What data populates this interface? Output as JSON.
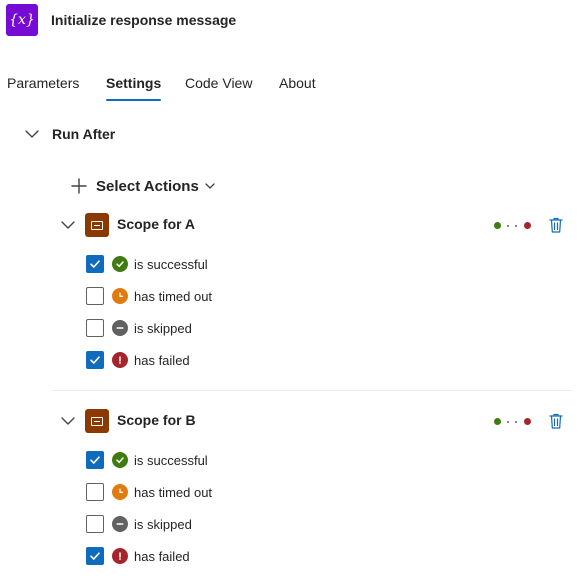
{
  "header": {
    "title": "Initialize response message",
    "icon": "variable-icon",
    "icon_glyph": "{x}",
    "icon_color": "#770bd6"
  },
  "tabs": [
    {
      "label": "Parameters",
      "active": false
    },
    {
      "label": "Settings",
      "active": true
    },
    {
      "label": "Code View",
      "active": false
    },
    {
      "label": "About",
      "active": false
    }
  ],
  "run_after": {
    "label": "Run After",
    "expanded": true
  },
  "select_actions": {
    "label": "Select Actions"
  },
  "colors": {
    "accent": "#0f6cbd",
    "scope_icon": "#8c3900",
    "success": "#3f7b0e",
    "timeout": "#e07b10",
    "skipped": "#616161",
    "failed": "#a4262c"
  },
  "scopes": [
    {
      "name": "Scope for A",
      "options": [
        {
          "label": "is successful",
          "checked": true,
          "status": "success"
        },
        {
          "label": "has timed out",
          "checked": false,
          "status": "timeout"
        },
        {
          "label": "is skipped",
          "checked": false,
          "status": "skipped"
        },
        {
          "label": "has failed",
          "checked": true,
          "status": "failed"
        }
      ]
    },
    {
      "name": "Scope for B",
      "options": [
        {
          "label": "is successful",
          "checked": true,
          "status": "success"
        },
        {
          "label": "has timed out",
          "checked": false,
          "status": "timeout"
        },
        {
          "label": "is skipped",
          "checked": false,
          "status": "skipped"
        },
        {
          "label": "has failed",
          "checked": true,
          "status": "failed"
        }
      ]
    }
  ]
}
